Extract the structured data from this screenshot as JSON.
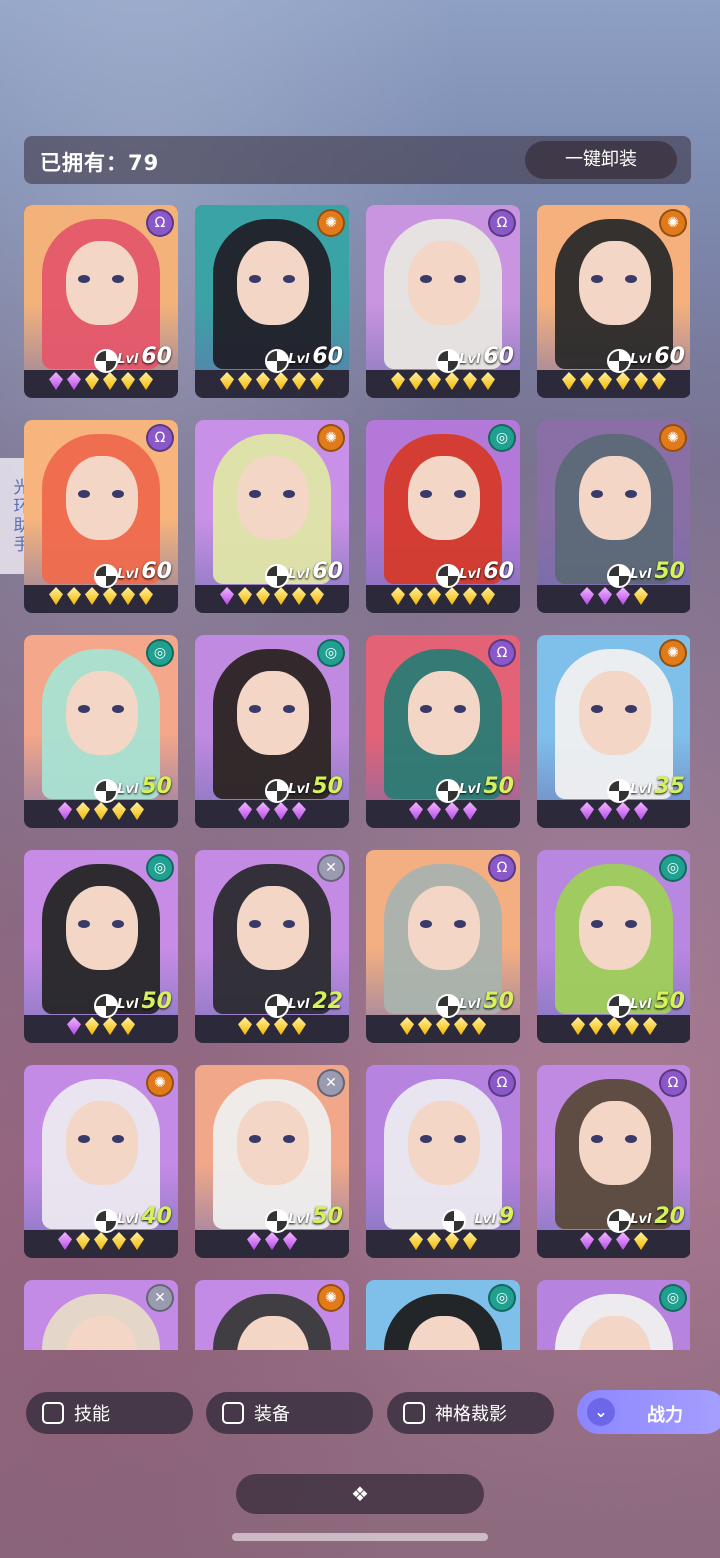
{
  "header": {
    "owned_label": "已拥有：79",
    "unequip_label": "一键卸装"
  },
  "side": {
    "helper_label": "光环助手"
  },
  "heroes": [
    {
      "level": "60",
      "element": "omega",
      "stars": [
        "purple",
        "purple",
        "gold",
        "gold",
        "gold",
        "gold"
      ],
      "bg": "#f3b27a",
      "hair": "#e4576a"
    },
    {
      "level": "60",
      "element": "sun",
      "stars": [
        "gold",
        "gold",
        "gold",
        "gold",
        "gold",
        "gold"
      ],
      "bg": "#3aa3a6",
      "hair": "#202028"
    },
    {
      "level": "60",
      "element": "omega",
      "stars": [
        "gold",
        "gold",
        "gold",
        "gold",
        "gold",
        "gold"
      ],
      "bg": "#c994e0",
      "hair": "#e8e6e0"
    },
    {
      "level": "60",
      "element": "sun",
      "stars": [
        "gold",
        "gold",
        "gold",
        "gold",
        "gold",
        "gold"
      ],
      "bg": "#f5b07e",
      "hair": "#2a2a2a"
    },
    {
      "level": "60",
      "element": "omega",
      "stars": [
        "gold",
        "gold",
        "gold",
        "gold",
        "gold",
        "gold"
      ],
      "bg": "#f7b47c",
      "hair": "#ef6a4e"
    },
    {
      "level": "60",
      "element": "sun",
      "stars": [
        "purple",
        "gold",
        "gold",
        "gold",
        "gold",
        "gold"
      ],
      "bg": "#c890e6",
      "hair": "#dfe6a6"
    },
    {
      "level": "60",
      "element": "swirl",
      "stars": [
        "gold",
        "gold",
        "gold",
        "gold",
        "gold",
        "gold"
      ],
      "bg": "#b479d8",
      "hair": "#d53a2a"
    },
    {
      "level": "50",
      "element": "sun",
      "stars": [
        "purple",
        "purple",
        "purple",
        "gold"
      ],
      "bg": "#8a6ea6",
      "hair": "#5c6876"
    },
    {
      "level": "50",
      "element": "swirl",
      "stars": [
        "purple",
        "gold",
        "gold",
        "gold",
        "gold"
      ],
      "bg": "#f4a78a",
      "hair": "#a8e2d2"
    },
    {
      "level": "50",
      "element": "swirl",
      "stars": [
        "purple",
        "purple",
        "purple",
        "purple"
      ],
      "bg": "#c08ae0",
      "hair": "#2b2422"
    },
    {
      "level": "50",
      "element": "omega",
      "stars": [
        "purple",
        "purple",
        "purple",
        "purple"
      ],
      "bg": "#e46276",
      "hair": "#2b7b74"
    },
    {
      "level": "35",
      "element": "sun",
      "stars": [
        "purple",
        "purple",
        "purple",
        "purple"
      ],
      "bg": "#7fc0ea",
      "hair": "#f0f0f0"
    },
    {
      "level": "50",
      "element": "swirl",
      "stars": [
        "purple",
        "gold",
        "gold",
        "gold"
      ],
      "bg": "#c68ce6",
      "hair": "#262626"
    },
    {
      "level": "22",
      "element": "cross",
      "stars": [
        "gold",
        "gold",
        "gold",
        "gold"
      ],
      "bg": "#c48be4",
      "hair": "#2b2b30"
    },
    {
      "level": "50",
      "element": "omega",
      "stars": [
        "gold",
        "gold",
        "gold",
        "gold",
        "gold"
      ],
      "bg": "#f3ae82",
      "hair": "#a9b3ae"
    },
    {
      "level": "50",
      "element": "swirl",
      "stars": [
        "gold",
        "gold",
        "gold",
        "gold",
        "gold"
      ],
      "bg": "#b887e0",
      "hair": "#9ecf5a"
    },
    {
      "level": "40",
      "element": "sun",
      "stars": [
        "purple",
        "gold",
        "gold",
        "gold",
        "gold"
      ],
      "bg": "#c48be6",
      "hair": "#ece8f0"
    },
    {
      "level": "50",
      "element": "cross",
      "stars": [
        "purple",
        "purple",
        "purple"
      ],
      "bg": "#f1a88a",
      "hair": "#eeeeee"
    },
    {
      "level": "9",
      "element": "omega",
      "stars": [
        "gold",
        "gold",
        "gold",
        "gold"
      ],
      "bg": "#b683de",
      "hair": "#eceaf0"
    },
    {
      "level": "20",
      "element": "omega",
      "stars": [
        "purple",
        "purple",
        "purple",
        "gold"
      ],
      "bg": "#c08ae2",
      "hair": "#5a4a3a"
    },
    {
      "level": "",
      "element": "cross",
      "stars": [],
      "bg": "#c48be6",
      "hair": "#e6dac6"
    },
    {
      "level": "",
      "element": "sun",
      "stars": [],
      "bg": "#c48be6",
      "hair": "#3a3a3a"
    },
    {
      "level": "",
      "element": "swirl",
      "stars": [],
      "bg": "#7fc0ea",
      "hair": "#1e1e1e"
    },
    {
      "level": "",
      "element": "swirl",
      "stars": [],
      "bg": "#b683de",
      "hair": "#f0f0f0"
    }
  ],
  "filters": {
    "skill": "技能",
    "equipment": "装备",
    "divine": "神格裁影",
    "power": "战力"
  },
  "expand_glyph": "❖",
  "colors": {
    "gold_star": "#f3b800",
    "purple_star": "#b54be8",
    "power_button": "#8c86ff"
  }
}
